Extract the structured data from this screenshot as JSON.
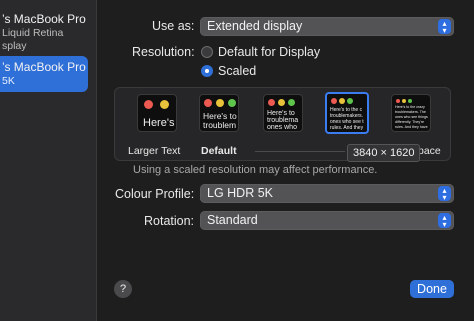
{
  "sidebar": {
    "items": [
      {
        "line1": "’s MacBook Pro",
        "line2": "Liquid Retina",
        "line3": "splay",
        "selected": false
      },
      {
        "line1": "’s MacBook Pro",
        "line2": "5K",
        "selected": true
      }
    ]
  },
  "use_as": {
    "label": "Use as:",
    "value": "Extended display"
  },
  "resolution": {
    "label": "Resolution:",
    "options": [
      {
        "label": "Default for Display",
        "checked": false
      },
      {
        "label": "Scaled",
        "checked": true
      }
    ]
  },
  "scaled": {
    "thumbs": [
      {
        "text": "Here's",
        "label": "Larger Text"
      },
      {
        "text_lines": [
          "Here's to",
          "troublem"
        ],
        "label": "Default"
      },
      {
        "text_lines": [
          "Here's to",
          "troublema",
          "ones who"
        ]
      },
      {
        "text_lines": [
          "Here's to the c",
          "troublemakers.",
          "ones who see t",
          "rules. And they"
        ],
        "selected": true
      },
      {
        "text_lines": [
          "Here's to the crazy",
          "troublemakers. The",
          "ones who see things",
          "differently. They're",
          "rules. And they have"
        ],
        "label": "pace"
      }
    ],
    "tooltip": "3840 × 1620",
    "note": "Using a scaled resolution may affect performance."
  },
  "colour_profile": {
    "label": "Colour Profile:",
    "value": "LG HDR 5K"
  },
  "rotation": {
    "label": "Rotation:",
    "value": "Standard"
  },
  "buttons": {
    "help": "?",
    "done": "Done"
  },
  "colors": {
    "accent": "#2f6fd8",
    "traffic_red": "#ec5a51",
    "traffic_yellow": "#e8c23a",
    "traffic_green": "#5ec44b"
  }
}
